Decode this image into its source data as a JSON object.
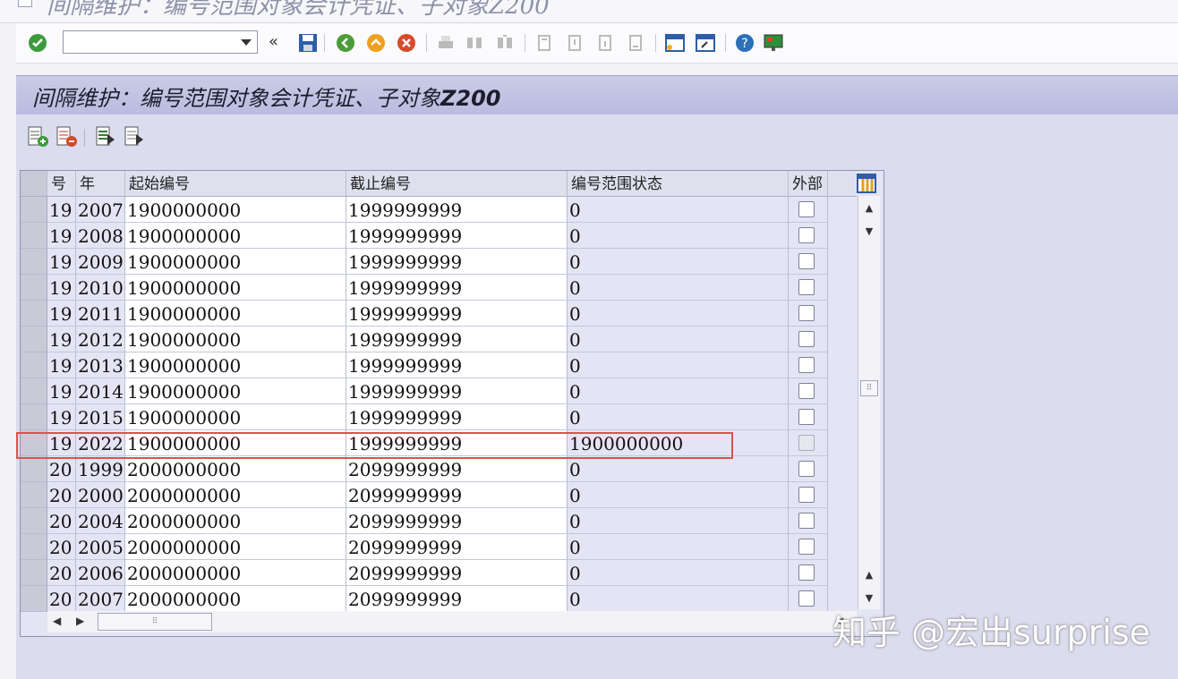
{
  "window": {
    "title": "间隔维护：编号范围对象会计凭证、子对象Z200"
  },
  "toolbar": {
    "command_value": "",
    "collapse_glyph": "«",
    "icons": [
      "enter-icon",
      "save-icon",
      "back-icon",
      "exit-icon",
      "cancel-icon",
      "print-icon",
      "find-icon",
      "find-next-icon",
      "first-page-icon",
      "previous-page-icon",
      "next-page-icon",
      "last-page-icon",
      "create-session-icon",
      "shortcut-icon",
      "help-icon",
      "customize-layout-icon"
    ]
  },
  "header": {
    "title_prefix": "间隔维护：编号范围对象会计凭证、子对象",
    "title_bold": "Z200"
  },
  "subtoolbar": {
    "icons": [
      "insert-line-icon",
      "delete-line-icon",
      "select-all-icon",
      "deselect-all-icon"
    ]
  },
  "table": {
    "columns": [
      "号",
      "年",
      "起始编号",
      "截止编号",
      "编号范围状态",
      "外部"
    ],
    "rows": [
      {
        "no": "19",
        "year": "2007",
        "from": "1900000000",
        "to": "1999999999",
        "status": "0",
        "external": false
      },
      {
        "no": "19",
        "year": "2008",
        "from": "1900000000",
        "to": "1999999999",
        "status": "0",
        "external": false
      },
      {
        "no": "19",
        "year": "2009",
        "from": "1900000000",
        "to": "1999999999",
        "status": "0",
        "external": false
      },
      {
        "no": "19",
        "year": "2010",
        "from": "1900000000",
        "to": "1999999999",
        "status": "0",
        "external": false
      },
      {
        "no": "19",
        "year": "2011",
        "from": "1900000000",
        "to": "1999999999",
        "status": "0",
        "external": false
      },
      {
        "no": "19",
        "year": "2012",
        "from": "1900000000",
        "to": "1999999999",
        "status": "0",
        "external": false
      },
      {
        "no": "19",
        "year": "2013",
        "from": "1900000000",
        "to": "1999999999",
        "status": "0",
        "external": false
      },
      {
        "no": "19",
        "year": "2014",
        "from": "1900000000",
        "to": "1999999999",
        "status": "0",
        "external": false
      },
      {
        "no": "19",
        "year": "2015",
        "from": "1900000000",
        "to": "1999999999",
        "status": "0",
        "external": false
      },
      {
        "no": "19",
        "year": "2022",
        "from": "1900000000",
        "to": "1999999999",
        "status": "1900000000",
        "external": false,
        "highlighted": true
      },
      {
        "no": "20",
        "year": "1999",
        "from": "2000000000",
        "to": "2099999999",
        "status": "0",
        "external": false
      },
      {
        "no": "20",
        "year": "2000",
        "from": "2000000000",
        "to": "2099999999",
        "status": "0",
        "external": false
      },
      {
        "no": "20",
        "year": "2004",
        "from": "2000000000",
        "to": "2099999999",
        "status": "0",
        "external": false
      },
      {
        "no": "20",
        "year": "2005",
        "from": "2000000000",
        "to": "2099999999",
        "status": "0",
        "external": false
      },
      {
        "no": "20",
        "year": "2006",
        "from": "2000000000",
        "to": "2099999999",
        "status": "0",
        "external": false
      },
      {
        "no": "20",
        "year": "2007",
        "from": "2000000000",
        "to": "2099999999",
        "status": "0",
        "external": false
      }
    ]
  },
  "watermark": "知乎 @宏出surprise",
  "colors": {
    "header_bg": "#c9cbe6",
    "highlight_border": "#d9534f",
    "editable_cell": "#ffffff",
    "readonly_cell": "#e4e4f4"
  }
}
